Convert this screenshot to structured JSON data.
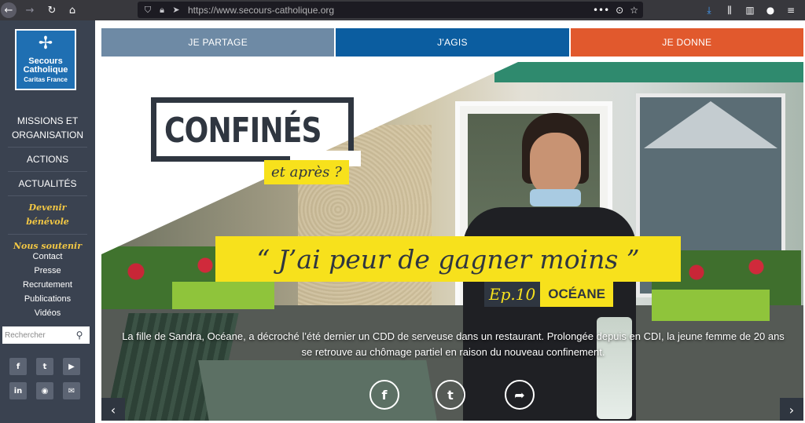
{
  "browser": {
    "url": "https://www.secours-catholique.org",
    "icons": [
      "back-icon",
      "forward-icon",
      "reload-icon",
      "home-icon",
      "shield-icon",
      "lock-icon",
      "location-arrow-icon",
      "more-icon",
      "pocket-icon",
      "bookmark-star-icon",
      "download-icon",
      "library-icon",
      "sidebar-icon",
      "account-icon",
      "menu-icon"
    ]
  },
  "logo": {
    "line1": "Secours",
    "line2": "Catholique",
    "line3": "Caritas France"
  },
  "nav": {
    "items": [
      {
        "label": "MISSIONS ET ORGANISATION"
      },
      {
        "label": "ACTIONS"
      },
      {
        "label": "ACTUALITÉS"
      },
      {
        "label": "Devenir bénévole"
      },
      {
        "label": "Nous soutenir"
      }
    ],
    "sub_items": [
      {
        "label": "Contact"
      },
      {
        "label": "Presse"
      },
      {
        "label": "Recrutement"
      },
      {
        "label": "Publications"
      },
      {
        "label": "Vidéos"
      }
    ]
  },
  "search": {
    "placeholder": "Rechercher"
  },
  "social": {
    "icons": [
      "facebook-icon",
      "twitter-icon",
      "youtube-icon",
      "linkedin-icon",
      "rss-icon",
      "email-icon"
    ]
  },
  "tabs": [
    {
      "label": "JE PARTAGE",
      "color": "#6e8aa5"
    },
    {
      "label": "J'AGIS",
      "color": "#0b5da0"
    },
    {
      "label": "JE DONNE",
      "color": "#e1592d"
    }
  ],
  "hero": {
    "title": "CONFINÉS",
    "subtitle": "et après ?",
    "quote": "“ J’ai peur de gagner moins ”",
    "episode": "Ep.10",
    "name": "OCÉANE",
    "description": "La fille de Sandra, Océane, a décroché l’été dernier un CDD de serveuse dans un restaurant. Prolongée depuis en CDI, la jeune femme de 20 ans se retrouve au chômage partiel en raison du nouveau confinement."
  },
  "colors": {
    "sidebar": "#3a4250",
    "accent_yellow": "#f7e11c",
    "dark_text": "#2f3640"
  }
}
